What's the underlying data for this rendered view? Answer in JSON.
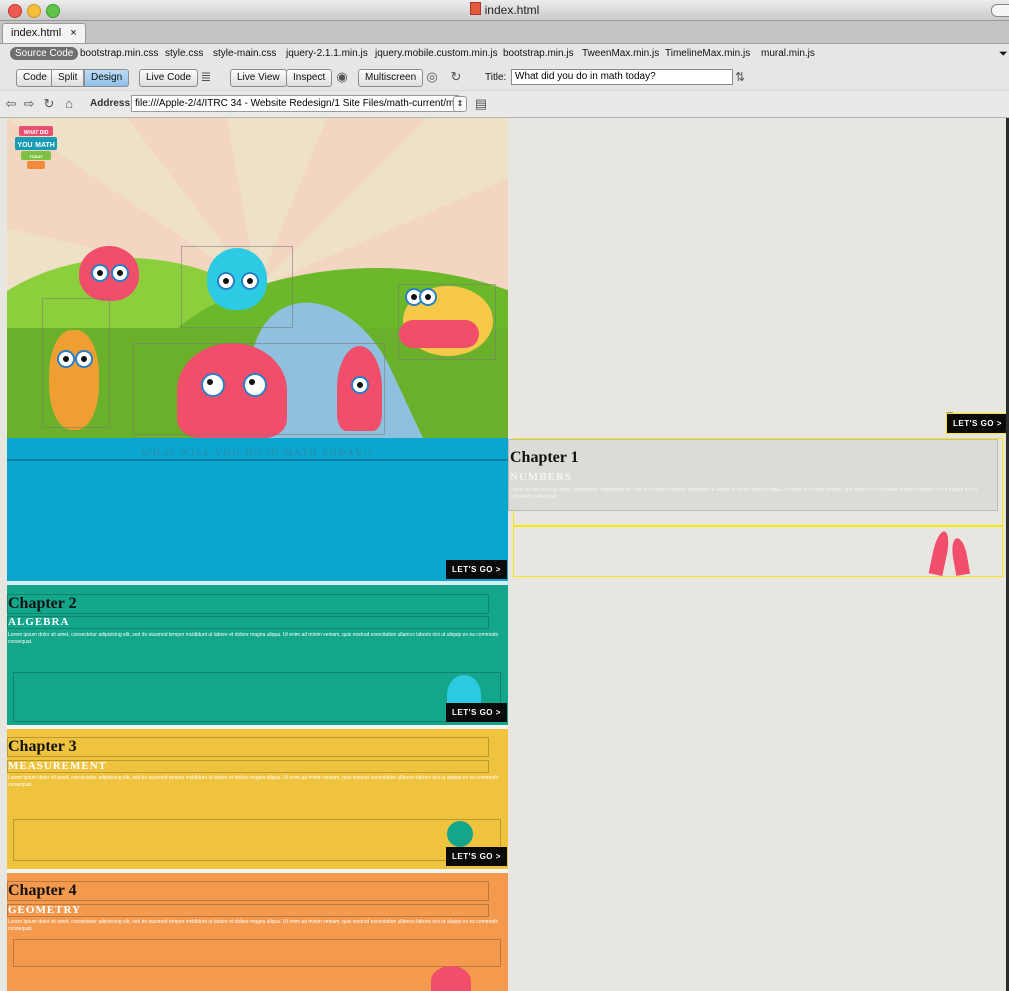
{
  "window": {
    "title": "index.html"
  },
  "tab": {
    "label": "index.html",
    "close": "×"
  },
  "related_files": [
    "Source Code",
    "bootstrap.min.css",
    "style.css",
    "style-main.css",
    "jquery-2.1.1.min.js",
    "jquery.mobile.custom.min.js",
    "bootstrap.min.js",
    "TweenMax.min.js",
    "TimelineMax.min.js",
    "mural.min.js"
  ],
  "toolbar": {
    "code": "Code",
    "split": "Split",
    "design": "Design",
    "live_code": "Live Code",
    "live_view": "Live View",
    "inspect": "Inspect",
    "multiscreen": "Multiscreen",
    "title_label": "Title:",
    "title_value": "What did you do in math today?"
  },
  "address": {
    "label": "Address:",
    "value": "file:///Apple-2/4/ITRC 34 - Website Redesign/1 Site Files/math-current/ma"
  },
  "logo": {
    "line1": "WHAT DID",
    "line2": "YOU",
    "line3": "MATH",
    "line4": "TODAY"
  },
  "hero": {
    "banner": "WHAT WILL YOU DO IN MATH TODAY!!",
    "cta": "LET'S GO >"
  },
  "chapters": [
    {
      "title": "Chapter 1",
      "subtitle": "NUMBERS",
      "text": "Lorem ipsum dolor sit amet, consectetur adipisicing elit, sed do eiusmod tempor incididunt ut labore et dolore magna aliqua. Ut enim ad minim veniam, quis nostrud exercitation ullamco laboris nisi ut aliquip ex ea commodo consequat.",
      "cta": "LET'S GO >",
      "color": "#0aa6cf"
    },
    {
      "title": "Chapter 2",
      "subtitle": "ALGEBRA",
      "text": "Lorem ipsum dolor sit amet, consectetur adipisicing elit, sed do eiusmod tempor incididunt ut labore et dolore magna aliqua. Ut enim ad minim veniam, quis nostrud exercitation ullamco laboris nisi ut aliquip ex ea commodo consequat.",
      "cta": "LET'S GO >",
      "color": "#14a68b"
    },
    {
      "title": "Chapter 3",
      "subtitle": "MEASUREMENT",
      "text": "Lorem ipsum dolor sit amet, consectetur adipisicing elit, sed do eiusmod tempor incididunt ut labore et dolore magna aliqua. Ut enim ad minim veniam, quis nostrud exercitation ullamco laboris nisi ut aliquip ex ea commodo consequat.",
      "cta": "LET'S GO >",
      "color": "#f0c33e"
    },
    {
      "title": "Chapter 4",
      "subtitle": "GEOMETRY",
      "text": "Lorem ipsum dolor sit amet, consectetur adipisicing elit, sed do eiusmod tempor incididunt ut labore et dolore magna aliqua. Ut enim ad minim veniam, quis nostrud exercitation ullamco laboris nisi ut aliquip ex ea commodo consequat.",
      "color": "#f49a4e"
    }
  ],
  "colors": {
    "hero_sky": "#f2d6c1",
    "hill": "#6bb92b",
    "selection": "#f5e80a",
    "pink": "#f04e6a"
  }
}
